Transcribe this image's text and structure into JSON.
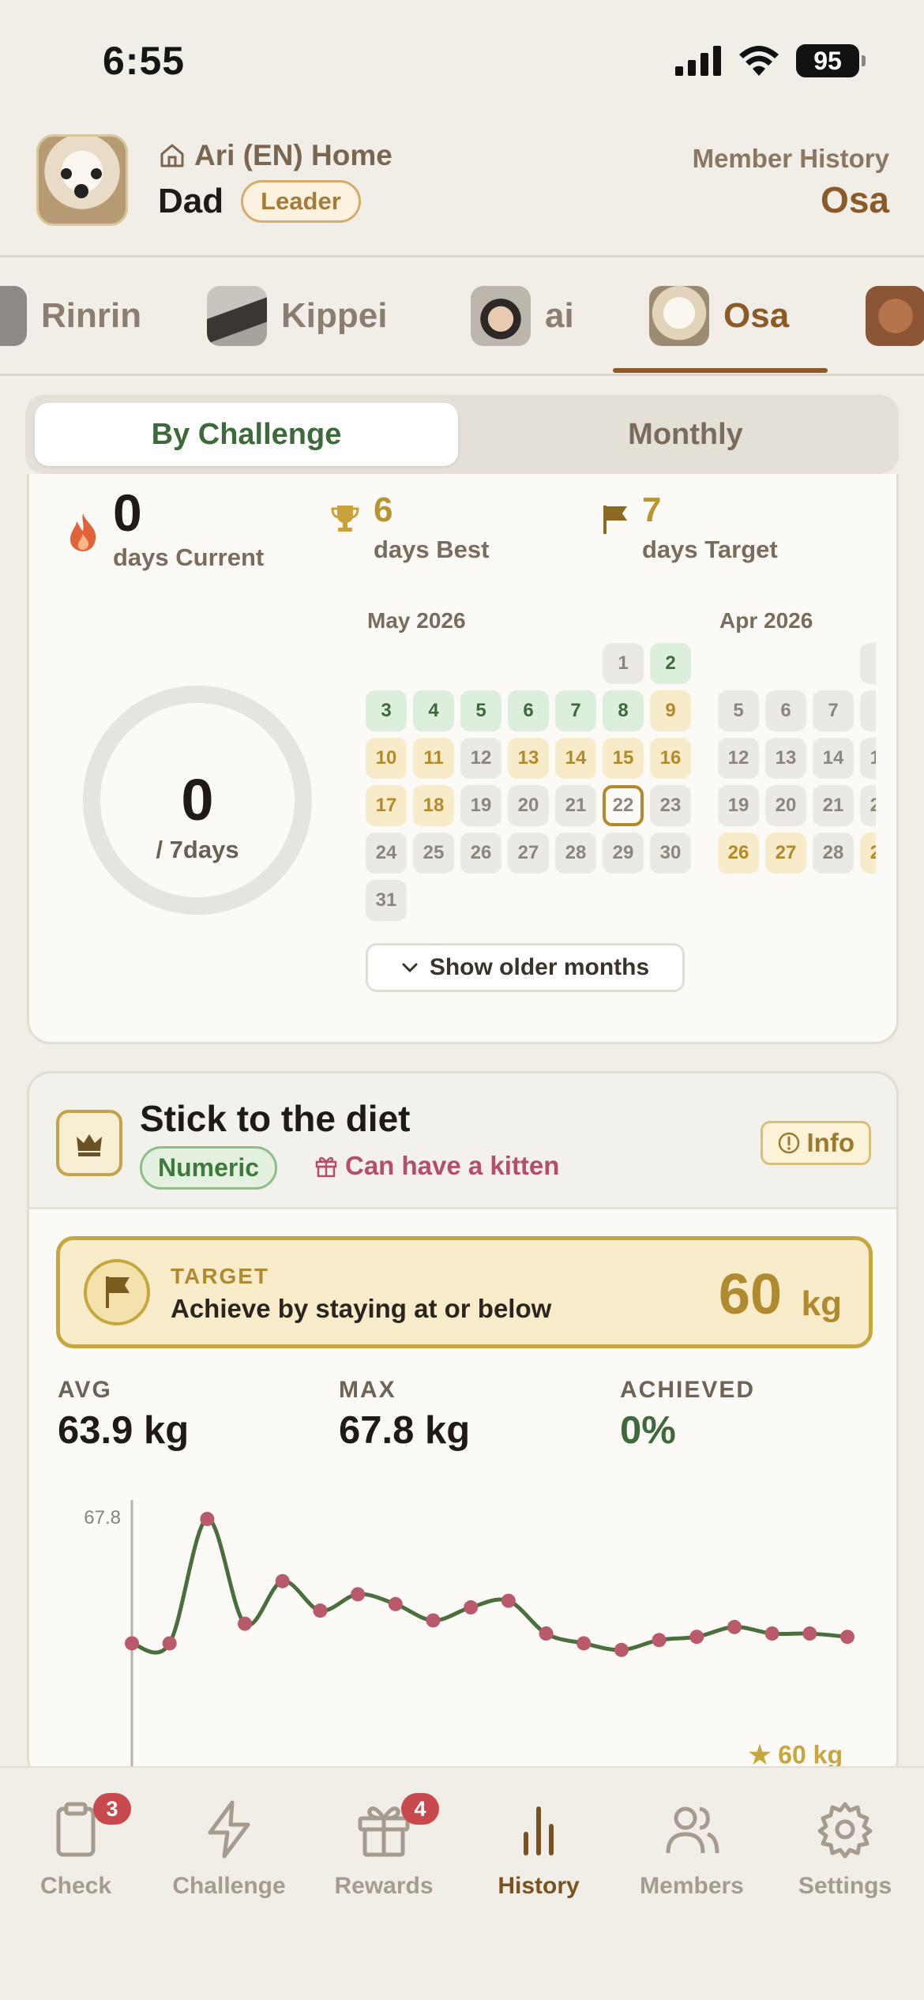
{
  "status": {
    "time": "6:55",
    "battery": "95"
  },
  "header": {
    "home_name": "Ari (EN) Home",
    "user_name": "Dad",
    "role": "Leader",
    "right_label": "Member History",
    "right_member": "Osa"
  },
  "members": [
    {
      "label": "Rinrin"
    },
    {
      "label": "Kippei"
    },
    {
      "label": "ai"
    },
    {
      "label": "Osa",
      "active": true
    }
  ],
  "segment": {
    "by_challenge": "By Challenge",
    "monthly": "Monthly"
  },
  "streak": {
    "current": "0",
    "current_label": "days Current",
    "best": "6",
    "best_label": "days Best",
    "target": "7",
    "target_label": "days Target",
    "ring_value": "0",
    "ring_sub": "/ 7days",
    "progress_fraction": 0
  },
  "calendar": {
    "may_title": "May 2026",
    "apr_title": "Apr 2026",
    "show_older": "Show older months"
  },
  "challenge": {
    "title": "Stick to the diet",
    "type_badge": "Numeric",
    "reward": "Can have a kitten",
    "info_label": "Info",
    "target_label": "TARGET",
    "target_desc": "Achieve by staying at or below",
    "target_value": "60",
    "target_unit": "kg",
    "avg_label": "AVG",
    "avg_value": "63.9 kg",
    "max_label": "MAX",
    "max_value": "67.8 kg",
    "achieved_label": "ACHIEVED",
    "achieved_value": "0%"
  },
  "chart_data": {
    "type": "line",
    "y_tick": "67.8",
    "target_label": "★ 60 kg",
    "target": 60,
    "ylim": [
      59.5,
      67.8
    ],
    "values": [
      64.0,
      64.0,
      67.8,
      64.6,
      65.9,
      65.0,
      65.5,
      65.2,
      64.7,
      65.1,
      65.3,
      64.3,
      64.0,
      63.8,
      64.1,
      64.2,
      64.5,
      64.3,
      64.3,
      64.2
    ],
    "colors": {
      "line": "#4a6e3e",
      "point": "#b85a6c",
      "target": "#c6a63e"
    }
  },
  "tabbar": [
    {
      "label": "Check",
      "badge": "3"
    },
    {
      "label": "Challenge"
    },
    {
      "label": "Rewards",
      "badge": "4"
    },
    {
      "label": "History",
      "active": true
    },
    {
      "label": "Members"
    },
    {
      "label": "Settings"
    }
  ]
}
